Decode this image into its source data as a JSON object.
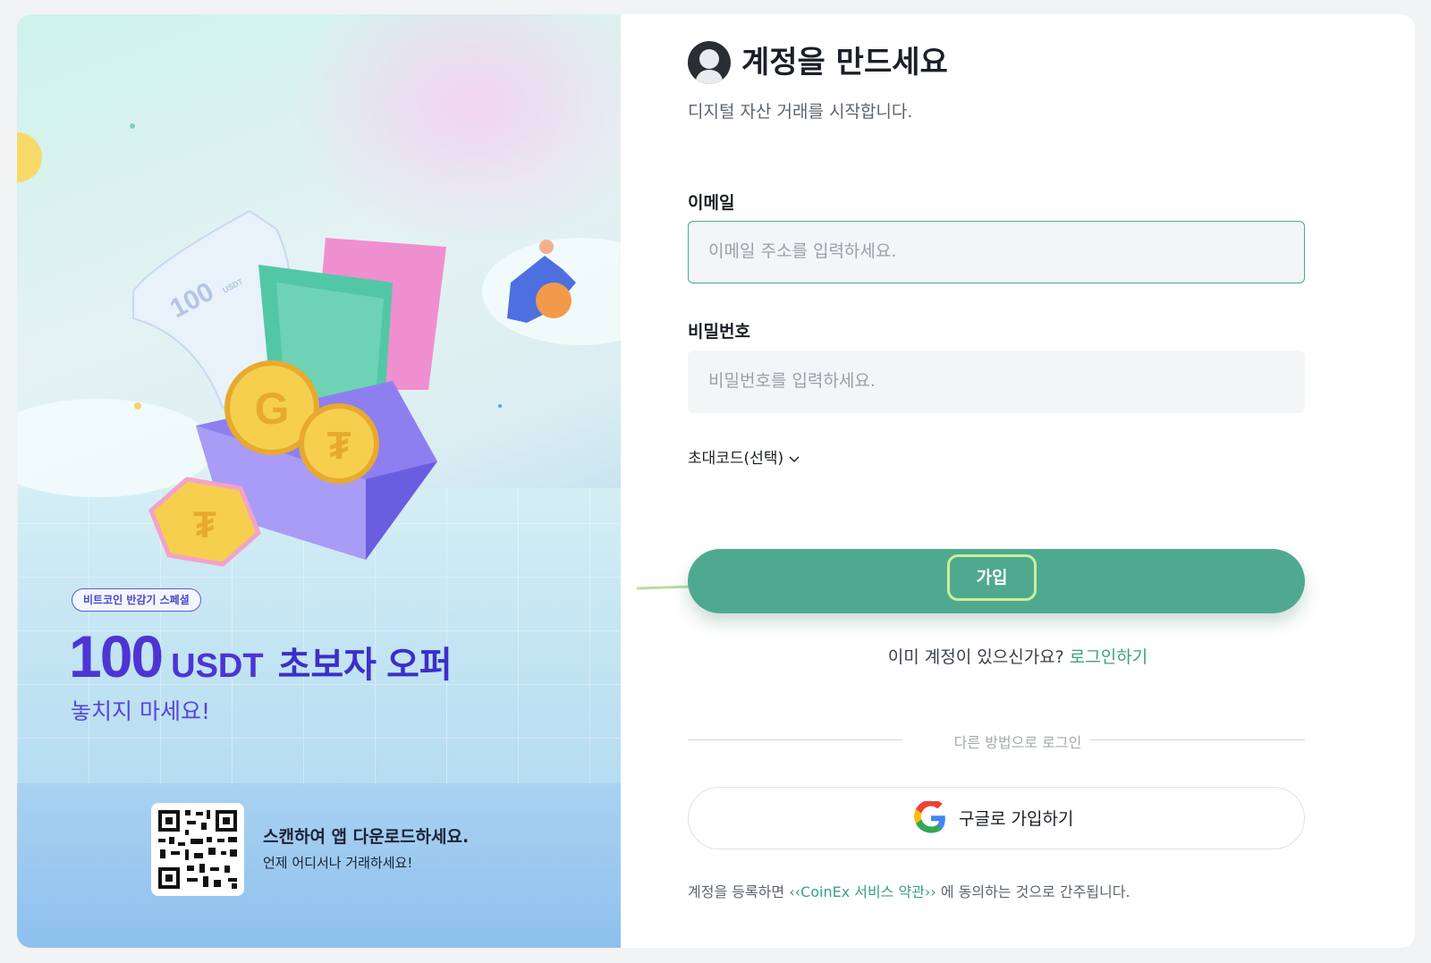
{
  "promo": {
    "tag": "비트코인 반감기 스페셜",
    "headline_amount": "100",
    "headline_unit": "USDT",
    "headline_rest": "초보자 오퍼",
    "subheadline": "놓치지 마세요!",
    "ticket_text": "100",
    "ticket_unit": "USDT",
    "qr_title": "스캔하여 앱 다운로드하세요.",
    "qr_subtitle": "언제 어디서나 거래하세요!"
  },
  "form": {
    "title": "계정을 만드세요",
    "subtitle": "디지털 자산 거래를 시작합니다.",
    "email_label": "이메일",
    "email_placeholder": "이메일 주소를 입력하세요.",
    "password_label": "비밀번호",
    "password_placeholder": "비밀번호를 입력하세요.",
    "invite_label": "초대코드(선택)",
    "signup_button": "가입",
    "have_account_text": "이미 계정이 있으신가요?",
    "login_link": "로그인하기",
    "divider_text": "다른 방법으로 로그인",
    "google_button": "구글로 가입하기",
    "terms_prefix": "계정을 등록하면",
    "terms_link": "‹‹CoinEx 서비스 약관››",
    "terms_suffix": "에 동의하는 것으로 간주됩니다."
  },
  "colors": {
    "accent": "#4fa98f",
    "link": "#3b9f86",
    "promo_purple": "#4d35d4"
  }
}
